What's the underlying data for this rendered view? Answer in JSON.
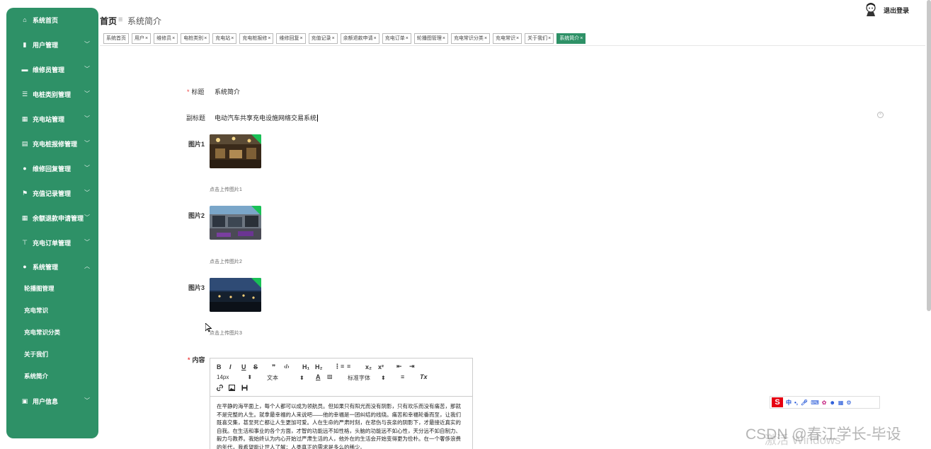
{
  "sidebar": {
    "items": [
      {
        "label": "系统首页",
        "icon": "home-icon",
        "glyph": "⌂",
        "has_chevron": false
      },
      {
        "label": "用户管理",
        "icon": "chart-icon",
        "glyph": "▮",
        "has_chevron": true
      },
      {
        "label": "维修员管理",
        "icon": "chat-icon",
        "glyph": "▬",
        "has_chevron": true
      },
      {
        "label": "电桩类别管理",
        "icon": "list-icon",
        "glyph": "☰",
        "has_chevron": true
      },
      {
        "label": "充电站管理",
        "icon": "grid-icon",
        "glyph": "▦",
        "has_chevron": true
      },
      {
        "label": "充电桩报修管理",
        "icon": "clipboard-icon",
        "glyph": "▤",
        "has_chevron": true
      },
      {
        "label": "维修回复管理",
        "icon": "user-icon",
        "glyph": "●",
        "has_chevron": true
      },
      {
        "label": "充值记录管理",
        "icon": "flag-icon",
        "glyph": "⚑",
        "has_chevron": true
      },
      {
        "label": "余额退款申请管理",
        "icon": "apps-icon",
        "glyph": "▦",
        "has_chevron": true
      },
      {
        "label": "充电订单管理",
        "icon": "signpost-icon",
        "glyph": "⊤",
        "has_chevron": true
      },
      {
        "label": "系统管理",
        "icon": "bulb-icon",
        "glyph": "●",
        "has_chevron": true
      },
      {
        "label": "用户信息",
        "icon": "id-card-icon",
        "glyph": "▣",
        "has_chevron": true
      }
    ],
    "sub_items": [
      "轮播图管理",
      "充电常识",
      "充电常识分类",
      "关于我们",
      "系统简介"
    ]
  },
  "header": {
    "breadcrumb_home": "首页",
    "breadcrumb_sep": "≡",
    "breadcrumb_current": "系统简介",
    "logout": "退出登录"
  },
  "tags": [
    {
      "label": "系统首页",
      "closable": false,
      "active": false
    },
    {
      "label": "用户",
      "closable": true,
      "active": false
    },
    {
      "label": "维修员",
      "closable": true,
      "active": false
    },
    {
      "label": "电桩类别",
      "closable": true,
      "active": false
    },
    {
      "label": "充电站",
      "closable": true,
      "active": false
    },
    {
      "label": "充电桩报修",
      "closable": true,
      "active": false
    },
    {
      "label": "维修回复",
      "closable": true,
      "active": false
    },
    {
      "label": "充值记录",
      "closable": true,
      "active": false
    },
    {
      "label": "余额退款申请",
      "closable": true,
      "active": false
    },
    {
      "label": "充电订单",
      "closable": true,
      "active": false
    },
    {
      "label": "轮播图管理",
      "closable": true,
      "active": false
    },
    {
      "label": "充电常识分类",
      "closable": true,
      "active": false
    },
    {
      "label": "充电常识",
      "closable": true,
      "active": false
    },
    {
      "label": "关于我们",
      "closable": true,
      "active": false
    },
    {
      "label": "系统简介",
      "closable": true,
      "active": true
    }
  ],
  "form": {
    "title_label": "标题",
    "title_value": "系统简介",
    "subtitle_label": "副标题",
    "subtitle_value": "电动汽车共享充电设施网络交易系统",
    "picture1_label": "图片1",
    "picture1_hint": "点击上传图片1",
    "picture2_label": "图片2",
    "picture2_hint": "点击上传图片2",
    "picture3_label": "图片3",
    "picture3_hint": "点击上传图片3",
    "content_label": "内容",
    "required_mark": "*"
  },
  "editor": {
    "toolbar": {
      "bold": "B",
      "italic": "I",
      "underline": "U",
      "strike": "S",
      "quote": "❞",
      "code": "‹/›",
      "h1": "H₁",
      "h2": "H₂",
      "ordered": "⋮≡",
      "bullet": "≡",
      "sub": "x₂",
      "sup": "x²",
      "outdent": "⇤",
      "indent": "⇥",
      "size": "14px",
      "format": "文本",
      "font": "标准字体",
      "color": "A",
      "bg": "▨",
      "align": "≡",
      "clear": "Tx"
    },
    "content": "在平静的海平面上，每个人都可以成为领航员。但如果只有阳光而没有阴影，只有欢乐而没有痛苦，那就不是完整的人生。就拿最幸福的人来说吧——他的幸福是一团纠结的线绕。痛苦和幸福轮番而至，让我们既喜交集，甚至死亡都让人生更加可爱。人在生命的严肃时刻，在悲伤与丧亲的阴影下，才最接近真实的自我。在生活和事业的各个方面，才智的功能远不如性格，头脑的功能远不如心性，天分远不如自制力、毅力与教养。我始终认为内心开始过严肃生活的人，他外在的生活会开始变得更为俭朴。在一个奢侈浪费的年代，我希望能让世人了解：人类真正的需求是多么的稀少。"
  },
  "ime": {
    "logo": "S",
    "lang": "中"
  },
  "watermark": "CSDN @春江学长-毕设",
  "watermark2": "激活 Windows",
  "colors": {
    "brand": "#2e9167",
    "required": "#e44444",
    "ime_red": "#e60012"
  }
}
